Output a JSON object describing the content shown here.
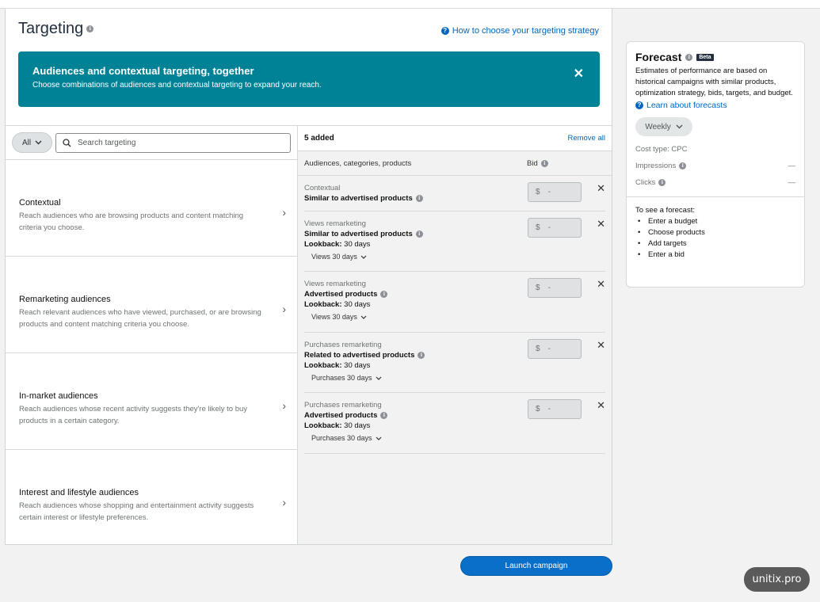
{
  "targeting": {
    "title": "Targeting",
    "help_link": "How to choose your targeting strategy",
    "banner": {
      "title": "Audiences and contextual targeting, together",
      "text": "Choose combinations of audiences and contextual targeting to expand your reach."
    },
    "filter": {
      "all_label": "All",
      "search_placeholder": "Search targeting"
    },
    "categories": [
      {
        "title": "Contextual",
        "desc": "Reach audiences who are browsing products and content matching criteria you choose."
      },
      {
        "title": "Remarketing audiences",
        "desc": "Reach relevant audiences who have viewed, purchased, or are browsing products and content matching criteria you choose."
      },
      {
        "title": "In-market audiences",
        "desc": "Reach audiences whose recent activity suggests they're likely to buy products in a certain category."
      },
      {
        "title": "Interest and lifestyle audiences",
        "desc": "Reach audiences whose shopping and entertainment activity suggests certain interest or lifestyle preferences."
      }
    ]
  },
  "added": {
    "count_label": "5 added",
    "remove_all": "Remove all",
    "col_name": "Audiences, categories, products",
    "col_bid": "Bid",
    "currency": "$",
    "bid_placeholder": "-",
    "lookback_label": "Lookback:",
    "rows": [
      {
        "type": "Contextual",
        "name": "Similar to advertised products",
        "lookback": "",
        "dropdown": ""
      },
      {
        "type": "Views remarketing",
        "name": "Similar to advertised products",
        "lookback": "30 days",
        "dropdown": "Views 30 days"
      },
      {
        "type": "Views remarketing",
        "name": "Advertised products",
        "lookback": "30 days",
        "dropdown": "Views 30 days"
      },
      {
        "type": "Purchases remarketing",
        "name": "Related to advertised products",
        "lookback": "30 days",
        "dropdown": "Purchases 30 days"
      },
      {
        "type": "Purchases remarketing",
        "name": "Advertised products",
        "lookback": "30 days",
        "dropdown": "Purchases 30 days"
      }
    ]
  },
  "launch_button": "Launch campaign",
  "forecast": {
    "title": "Forecast",
    "badge": "Beta",
    "desc": "Estimates of performance are based on historical campaigns with similar products, optimization strategy, bids, targets, and budget.",
    "learn_link": "Learn about forecasts",
    "period": "Weekly",
    "cost_type": "Cost type: CPC",
    "impressions_label": "Impressions",
    "impressions_value": "—",
    "clicks_label": "Clicks",
    "clicks_value": "—",
    "see_label": "To see a forecast:",
    "steps": [
      "Enter a budget",
      "Choose products",
      "Add targets",
      "Enter a bid"
    ]
  },
  "watermark": "unitix.pro",
  "colors": {
    "banner": "#008296",
    "link": "#0066c0",
    "primary_button": "#0a6fc9"
  }
}
